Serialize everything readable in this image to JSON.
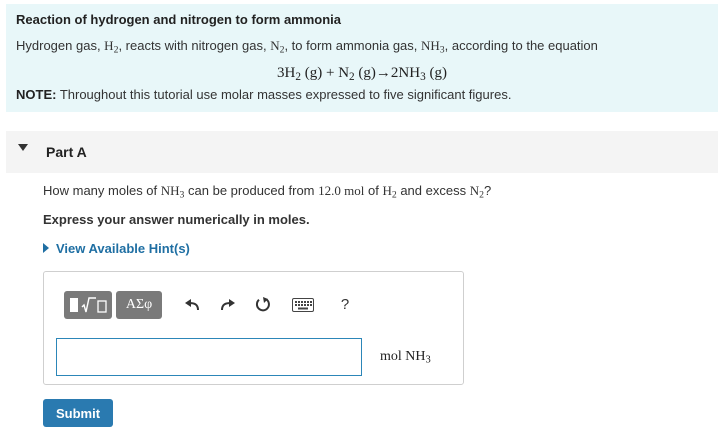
{
  "intro": {
    "title": "Reaction of hydrogen and nitrogen to form ammonia",
    "text_1": "Hydrogen gas, ",
    "h2": "H",
    "h2_sub": "2",
    "text_2": ", reacts with nitrogen gas, ",
    "n2": "N",
    "n2_sub": "2",
    "text_3": ", to form ammonia gas, ",
    "nh3": "NH",
    "nh3_sub": "3",
    "text_4": ", according to the equation",
    "equation": {
      "coef_h2": "3H",
      "sub_h2": "2",
      "state_1": " (g) + N",
      "sub_n2": "2",
      "state_2": " (g)→2NH",
      "sub_nh3": "3",
      "state_3": " (g)"
    },
    "note_label": "NOTE:",
    "note_text": " Throughout this tutorial use molar masses expressed to five significant figures."
  },
  "part": {
    "label": "Part A"
  },
  "question": {
    "text_1": "How many moles of ",
    "nh3": "NH",
    "nh3_sub": "3",
    "text_2": " can be produced from ",
    "amount": "12.0 mol",
    "text_3": " of ",
    "h2": "H",
    "h2_sub": "2",
    "text_4": " and excess ",
    "n2": "N",
    "n2_sub": "2",
    "text_5": "?"
  },
  "instruction": "Express your answer numerically in moles.",
  "hint_label": "View Available Hint(s)",
  "toolbar": {
    "greek_label": "ΑΣφ",
    "help_label": "?"
  },
  "answer": {
    "value": "",
    "placeholder": "",
    "unit": "mol NH",
    "unit_sub": "3"
  },
  "submit_label": "Submit"
}
